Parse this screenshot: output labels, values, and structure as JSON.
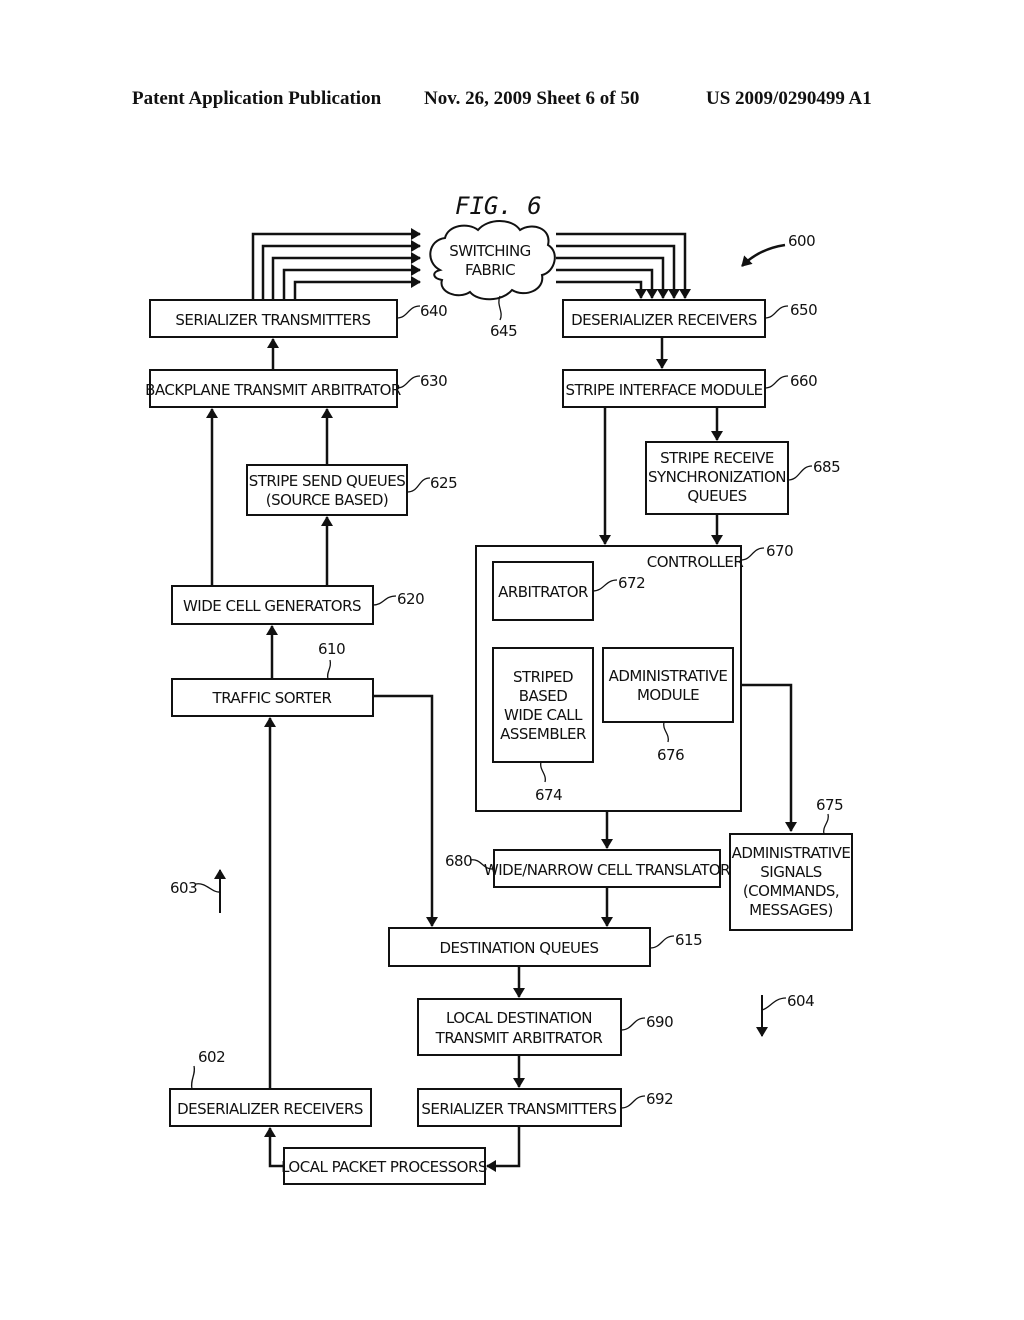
{
  "header": {
    "left": "Patent Application Publication",
    "middle": "Nov. 26, 2009   Sheet 6 of 50",
    "right": "US 2009/0290499 A1"
  },
  "figure": {
    "title": "FIG. 6",
    "ref_overall": "600",
    "ref_up_direction": "603",
    "ref_down_direction": "604"
  },
  "nodes": {
    "switching_fabric": {
      "lines": [
        "SWITCHING",
        "FABRIC"
      ],
      "ref": "645"
    },
    "serializer_tx_640": {
      "lines": [
        "SERIALIZER TRANSMITTERS"
      ],
      "ref": "640"
    },
    "backplane_arb_630": {
      "lines": [
        "BACKPLANE TRANSMIT ARBITRATOR"
      ],
      "ref": "630"
    },
    "stripe_send_625": {
      "lines": [
        "STRIPE SEND QUEUES",
        "(SOURCE BASED)"
      ],
      "ref": "625"
    },
    "wide_cell_gen_620": {
      "lines": [
        "WIDE CELL GENERATORS"
      ],
      "ref": "620"
    },
    "traffic_sorter_610": {
      "lines": [
        "TRAFFIC SORTER"
      ],
      "ref": "610"
    },
    "deserializer_rx_602": {
      "lines": [
        "DESERIALIZER RECEIVERS"
      ],
      "ref": "602"
    },
    "local_packet_proc": {
      "lines": [
        "LOCAL PACKET PROCESSORS"
      ]
    },
    "deserializer_rx_650": {
      "lines": [
        "DESERIALIZER RECEIVERS"
      ],
      "ref": "650"
    },
    "stripe_interface_660": {
      "lines": [
        "STRIPE INTERFACE MODULE"
      ],
      "ref": "660"
    },
    "stripe_rx_sync_685": {
      "lines": [
        "STRIPE RECEIVE",
        "SYNCHRONIZATION",
        "QUEUES"
      ],
      "ref": "685"
    },
    "controller_670": {
      "lines": [
        "CONTROLLER"
      ],
      "ref": "670"
    },
    "arbitrator_672": {
      "lines": [
        "ARBITRATOR"
      ],
      "ref": "672"
    },
    "assembler_674": {
      "lines": [
        "STRIPED",
        "BASED",
        "WIDE CALL",
        "ASSEMBLER"
      ],
      "ref": "674"
    },
    "admin_module_676": {
      "lines": [
        "ADMINISTRATIVE",
        "MODULE"
      ],
      "ref": "676"
    },
    "admin_signals_675": {
      "lines": [
        "ADMINISTRATIVE",
        "SIGNALS",
        "(COMMANDS,",
        "MESSAGES)"
      ],
      "ref": "675"
    },
    "translator_680": {
      "lines": [
        "WIDE/NARROW CELL TRANSLATOR"
      ],
      "ref": "680"
    },
    "dest_queues_615": {
      "lines": [
        "DESTINATION QUEUES"
      ],
      "ref": "615"
    },
    "local_dest_arb_690": {
      "lines": [
        "LOCAL DESTINATION",
        "TRANSMIT ARBITRATOR"
      ],
      "ref": "690"
    },
    "serializer_tx_692": {
      "lines": [
        "SERIALIZER TRANSMITTERS"
      ],
      "ref": "692"
    }
  },
  "edges": [
    {
      "from": "serializer_tx_640",
      "to": "switching_fabric",
      "count": 5
    },
    {
      "from": "switching_fabric",
      "to": "deserializer_rx_650",
      "count": 5
    },
    {
      "from": "backplane_arb_630",
      "to": "serializer_tx_640"
    },
    {
      "from": "stripe_send_625",
      "to": "backplane_arb_630"
    },
    {
      "from": "wide_cell_gen_620",
      "to": "backplane_arb_630"
    },
    {
      "from": "wide_cell_gen_620",
      "to": "stripe_send_625"
    },
    {
      "from": "traffic_sorter_610",
      "to": "wide_cell_gen_620"
    },
    {
      "from": "traffic_sorter_610",
      "to": "dest_queues_615"
    },
    {
      "from": "deserializer_rx_602",
      "to": "traffic_sorter_610"
    },
    {
      "from": "local_packet_proc",
      "to": "deserializer_rx_602"
    },
    {
      "from": "deserializer_rx_650",
      "to": "stripe_interface_660"
    },
    {
      "from": "stripe_interface_660",
      "to": "stripe_rx_sync_685"
    },
    {
      "from": "stripe_interface_660",
      "to": "controller_670"
    },
    {
      "from": "stripe_rx_sync_685",
      "to": "controller_670"
    },
    {
      "from": "controller_670",
      "to": "translator_680"
    },
    {
      "from": "admin_module_676",
      "to": "admin_signals_675"
    },
    {
      "from": "translator_680",
      "to": "dest_queues_615"
    },
    {
      "from": "dest_queues_615",
      "to": "local_dest_arb_690"
    },
    {
      "from": "local_dest_arb_690",
      "to": "serializer_tx_692"
    },
    {
      "from": "serializer_tx_692",
      "to": "local_packet_proc"
    }
  ]
}
